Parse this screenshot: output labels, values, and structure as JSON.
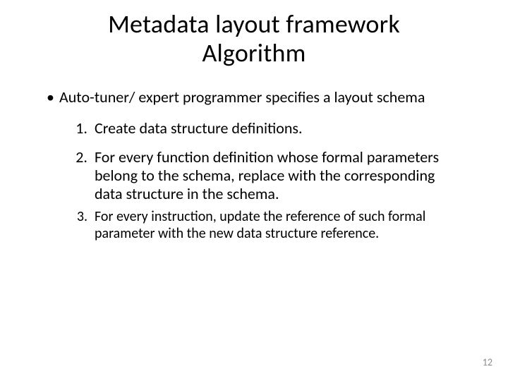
{
  "title_line1": "Metadata layout framework",
  "title_line2": "Algorithm",
  "bullet": {
    "marker": "•",
    "text": "Auto-tuner/ expert programmer specifies a layout schema"
  },
  "steps": [
    {
      "marker": "1.",
      "text": "Create data structure definitions."
    },
    {
      "marker": "2.",
      "text": "For every function definition whose formal parameters belong to the schema, replace with the corresponding data structure in the schema."
    },
    {
      "marker": "3.",
      "text": "For every instruction, update the reference of such formal parameter with the new data structure reference."
    }
  ],
  "page_number": "12"
}
